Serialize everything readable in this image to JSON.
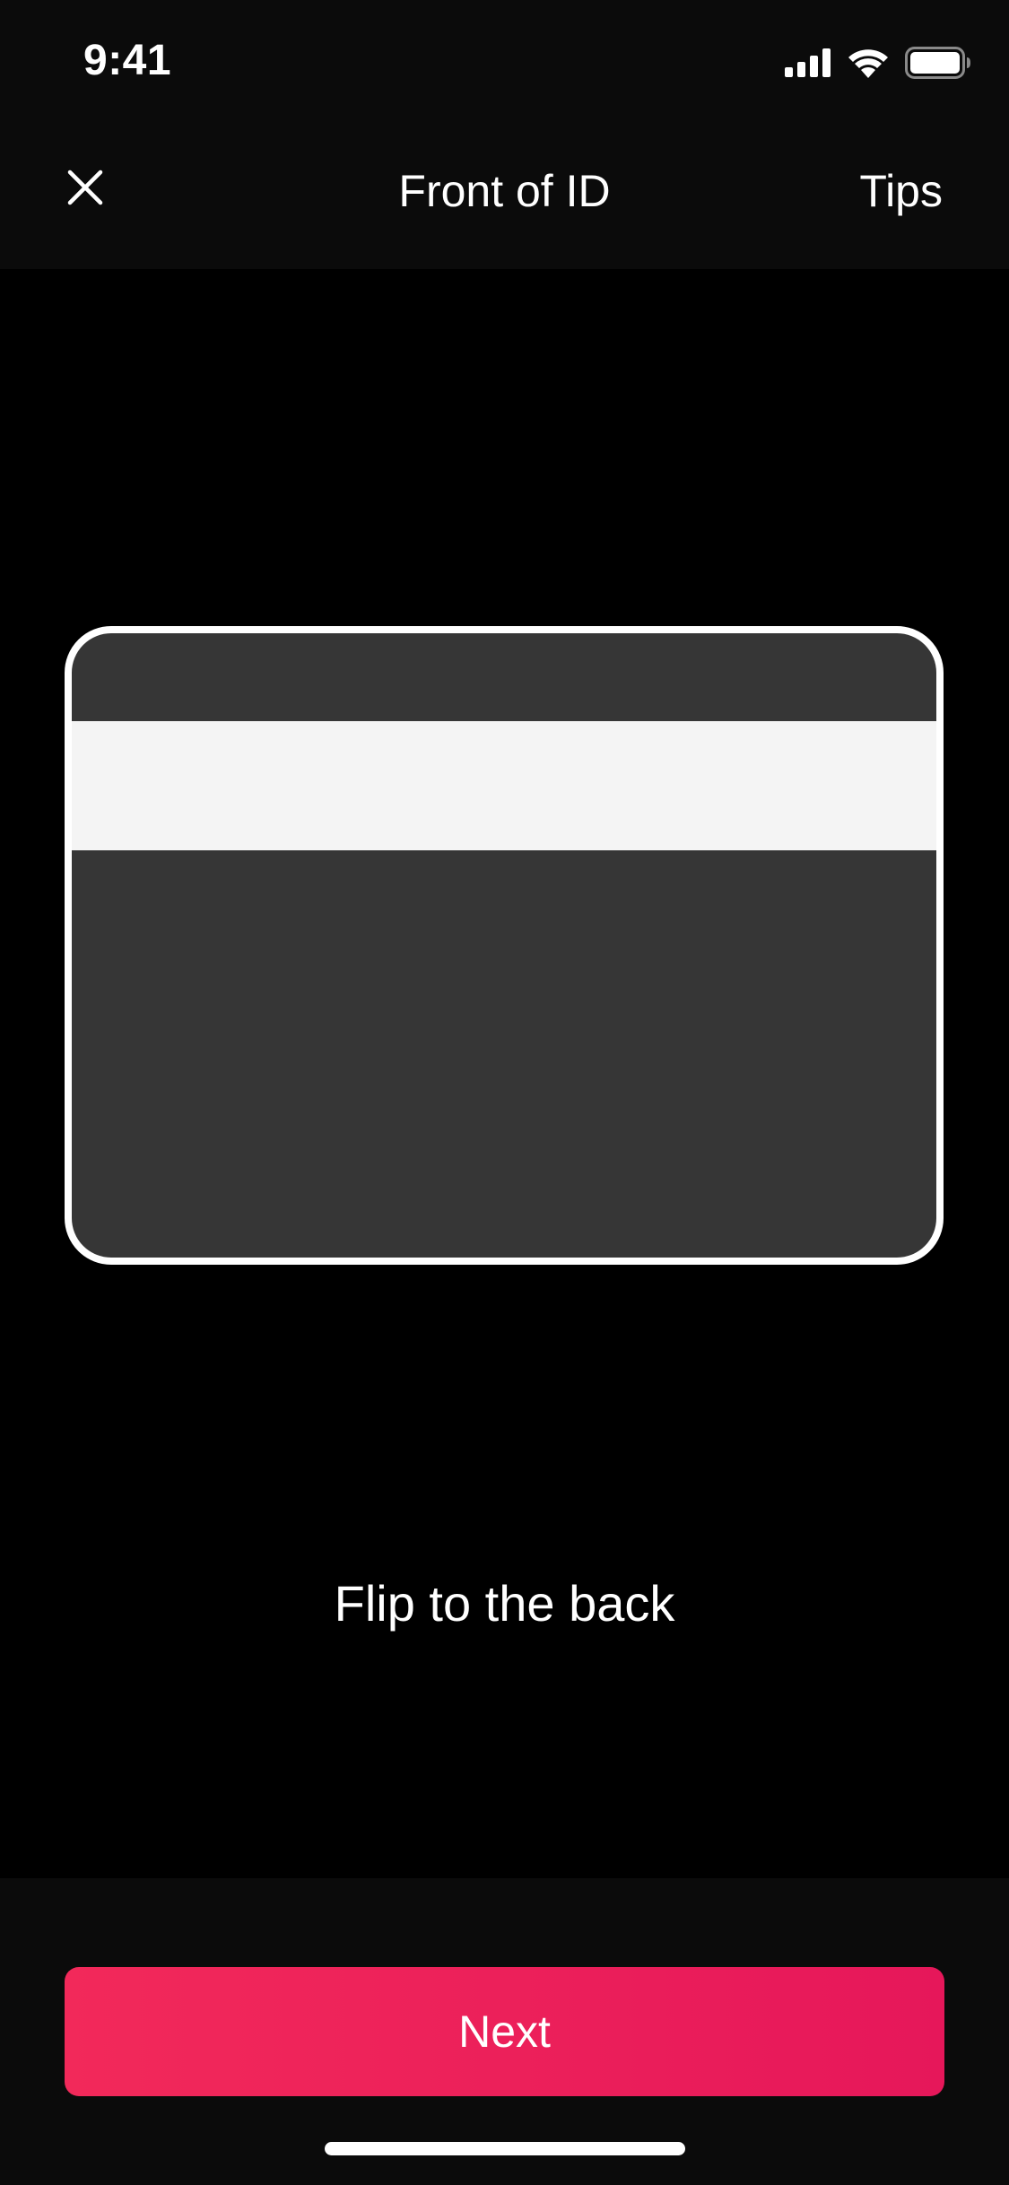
{
  "status_bar": {
    "time": "9:41",
    "icons": [
      "cellular-signal-icon",
      "wifi-icon",
      "battery-icon"
    ]
  },
  "nav": {
    "title": "Front of ID",
    "tips_label": "Tips",
    "close_icon": "close-icon"
  },
  "card": {
    "illustration": "id-card-back-icon",
    "colors": {
      "border": "#ffffff",
      "body": "#363636",
      "stripe": "#f4f4f4"
    }
  },
  "instruction": "Flip to the back",
  "footer": {
    "next_label": "Next"
  },
  "colors": {
    "accent": "#f2295a",
    "background": "#000000",
    "bars": "#0b0b0b"
  }
}
